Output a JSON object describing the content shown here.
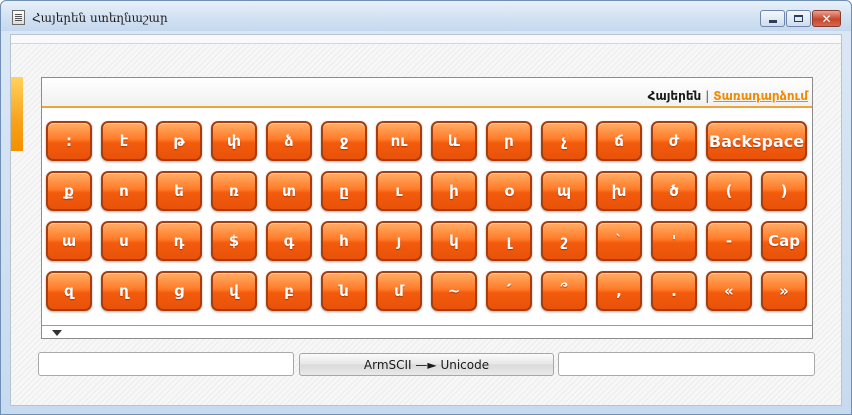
{
  "window": {
    "title": "Հայերեն ստեղնաշար",
    "minimize_icon": "minimize-icon",
    "maximize_icon": "maximize-icon",
    "close_icon": "close-icon",
    "close_glyph": "✕"
  },
  "keyboard": {
    "lang_active": "Հայերեն",
    "lang_separator": "|",
    "lang_other": "Տառադարձում",
    "accent_color": "#f07a22",
    "rows": [
      [
        ":",
        "է",
        "թ",
        "փ",
        "ձ",
        "ջ",
        "ու",
        "և",
        "ր",
        "չ",
        "ճ",
        "ժ",
        "Backspace"
      ],
      [
        "ք",
        "ո",
        "ե",
        "ռ",
        "տ",
        "ը",
        "ւ",
        "ի",
        "օ",
        "պ",
        "խ",
        "ծ",
        "(",
        ")"
      ],
      [
        "ա",
        "ս",
        "դ",
        "$",
        "գ",
        "հ",
        "յ",
        "կ",
        "լ",
        "շ",
        "`",
        "'",
        "-",
        "Cap"
      ],
      [
        "զ",
        "ղ",
        "ց",
        "վ",
        "բ",
        "ն",
        "մ",
        "~",
        "՛",
        "՞",
        ",",
        ".",
        "«",
        "»"
      ]
    ]
  },
  "converter": {
    "left_value": "",
    "button_label": "ArmSCII —► Unicode",
    "right_value": ""
  }
}
